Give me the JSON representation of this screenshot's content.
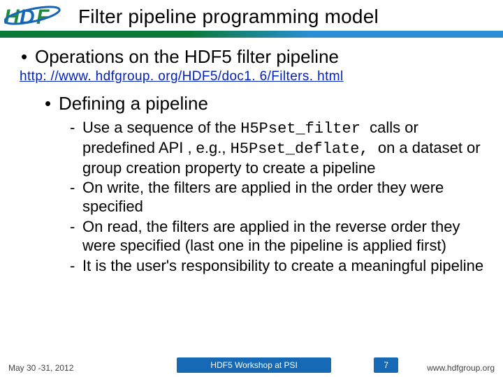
{
  "title": "Filter pipeline programming model",
  "bullets": {
    "l1": "Operations on the HDF5 filter pipeline",
    "link": "http: //www. hdfgroup. org/HDF5/doc1. 6/Filters. html",
    "l2": "Defining a pipeline",
    "l3": {
      "0": {
        "a": "Use  a sequence of the ",
        "code1": "H5Pset_filter ",
        "b": "calls or predefined API , e.g., ",
        "code2": "H5Pset_deflate, ",
        "c": "on a dataset or group creation property  to create a pipeline"
      },
      "1": "On write, the filters are applied in the order they were specified",
      "2": "On read, the filters are applied in the reverse order they were specified (last one in the pipeline is applied first)",
      "3": "It is the user's responsibility to create a meaningful pipeline"
    }
  },
  "footer": {
    "date": "May 30 -31, 2012",
    "event": "HDF5 Workshop at PSI",
    "page": "7",
    "url": "www.hdfgroup.org"
  }
}
